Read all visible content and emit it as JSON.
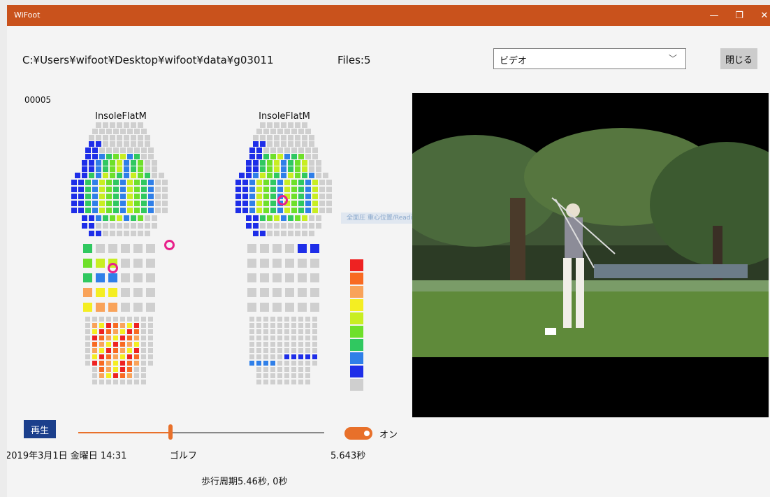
{
  "window": {
    "title": "WiFoot",
    "minimize_icon": "minimize-icon",
    "restore_icon": "restore-icon",
    "close_icon": "close-icon",
    "accent_color": "#c9521c"
  },
  "header": {
    "path": "C:¥Users¥wifoot¥Desktop¥wifoot¥data¥g03011",
    "files": "Files:5",
    "dropdown": {
      "selected": "ビデオ"
    },
    "close_label": "閉じる"
  },
  "insoles": {
    "counter": "00005",
    "left_label": "InsoleFlatM",
    "right_label": "InsoleFlatM",
    "tooltip": "全面圧 重心位置/Reading..."
  },
  "legend_colors": [
    "#ee2222",
    "#f86a22",
    "#f9a35a",
    "#f4ee22",
    "#c8ee22",
    "#6ee02a",
    "#30c860",
    "#2f7fe8",
    "#1e2ee8",
    "#cfcfcf"
  ],
  "controls": {
    "play_label": "再生",
    "slider_progress": 0.375,
    "toggle_on": true,
    "toggle_label": "オン",
    "date": "2019年3月1日 金曜日 14:31",
    "activity": "ゴルフ",
    "time": "5.643秒",
    "cycle": "歩行周期5.46秒, 0秒"
  }
}
